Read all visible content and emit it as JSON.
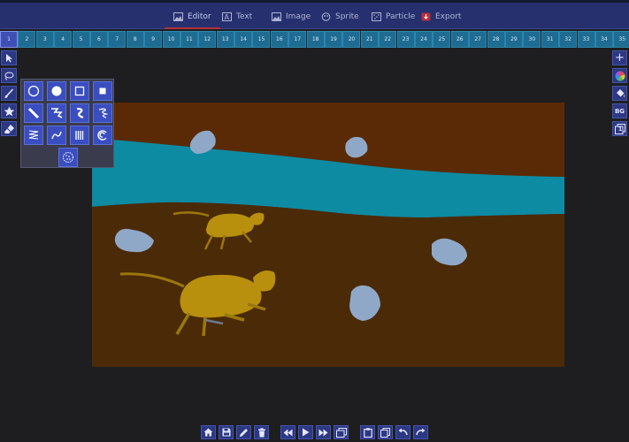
{
  "top_menu": {
    "tabs": [
      {
        "label": "Editor",
        "icon": "image-icon"
      },
      {
        "label": "Text",
        "icon": "text-icon"
      },
      {
        "label": "Image",
        "icon": "image-icon"
      },
      {
        "label": "Sprite",
        "icon": "sprite-icon"
      },
      {
        "label": "Particle",
        "icon": "particle-icon"
      },
      {
        "label": "Export",
        "icon": "export-icon"
      }
    ],
    "active": "Editor"
  },
  "frames": [
    "1",
    "2",
    "3",
    "4",
    "5",
    "6",
    "7",
    "8",
    "9",
    "10",
    "11",
    "12",
    "13",
    "14",
    "15",
    "16",
    "17",
    "18",
    "19",
    "20",
    "21",
    "22",
    "23",
    "24",
    "25",
    "26",
    "27",
    "28",
    "29",
    "30",
    "31",
    "32",
    "33",
    "34",
    "35"
  ],
  "selected_frame": "1",
  "left_tools": [
    "select-arrow-icon",
    "lasso-icon",
    "brush-icon",
    "star-icon",
    "eraser-icon"
  ],
  "right_tools": {
    "add": "+",
    "color": "color-wheel-icon",
    "fill": "paint-bucket-icon",
    "bg_label": "BG",
    "layer_label": "1"
  },
  "palette": [
    "circle-outline-icon",
    "circle-filled-icon",
    "square-outline-icon",
    "square-filled-icon",
    "line-icon",
    "zigzag-line-icon",
    "squiggle-icon",
    "spiral-coil-icon",
    "zigzag-stack-icon",
    "wave-icon",
    "vertical-lines-icon",
    "curl-icon",
    "spray-texture-icon"
  ],
  "bottom_toolbar": [
    "home-icon",
    "save-icon",
    "pencil-icon",
    "trash-icon",
    "rewind-icon",
    "play-icon",
    "fast-forward-icon",
    "frames-icon",
    "clipboard-icon",
    "copy-icon",
    "undo-icon",
    "redo-icon"
  ],
  "colors": {
    "menu_bg": "#27306e",
    "button_bg": "#2d3884",
    "accent": "#b3303b",
    "frame_bg": "#1f6c93",
    "sky": "#5a2a06",
    "river": "#0c8fa8",
    "ground": "#4a2a08",
    "rock": "#8fa8c8",
    "cat": "#b8900e"
  }
}
